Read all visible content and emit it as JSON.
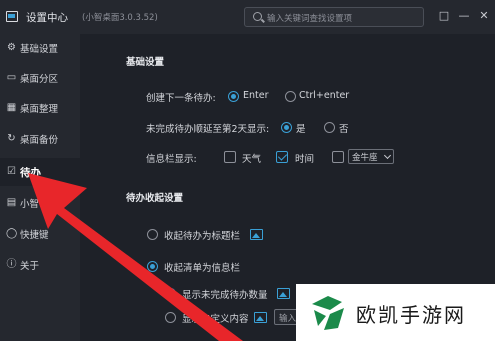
{
  "window": {
    "title": "设置中心",
    "version": "(小智桌面3.0.3.52)",
    "search_placeholder": "输入关键词查找设置项"
  },
  "sidebar": {
    "items": [
      {
        "label": "基础设置",
        "icon": "gear-icon"
      },
      {
        "label": "桌面分区",
        "icon": "monitor-icon"
      },
      {
        "label": "桌面整理",
        "icon": "grid-icon"
      },
      {
        "label": "桌面备份",
        "icon": "backup-icon"
      },
      {
        "label": "待办",
        "icon": "todo-icon",
        "active": true
      },
      {
        "label": "小智",
        "icon": "folder-icon"
      },
      {
        "label": "快捷键",
        "icon": "mouse-icon"
      },
      {
        "label": "关于",
        "icon": "info-icon"
      }
    ]
  },
  "basic": {
    "title": "基础设置",
    "next_todo_label": "创建下一条待办:",
    "next_todo_opt1": "Enter",
    "next_todo_opt2": "Ctrl+enter",
    "overdue_label": "未完成待办顺延至第2天显示:",
    "overdue_yes": "是",
    "overdue_no": "否",
    "infobar_label": "信息栏显示:",
    "infobar_weather": "天气",
    "infobar_time": "时间",
    "infobar_zodiac": "金牛座"
  },
  "collapse": {
    "title": "待办收起设置",
    "opt_titlebar": "收起待办为标题栏",
    "opt_infobar": "收起清单为信息栏",
    "sub_show_count": "显示未完成待办数量",
    "sub_custom": "显示自定义内容",
    "input_placeholder": "输入"
  },
  "watermark": {
    "text": "欧凯手游网"
  },
  "colors": {
    "accent": "#3aa0d6",
    "arrow": "#e8262a",
    "background": "#1e2128",
    "sidebar": "#25282f"
  }
}
